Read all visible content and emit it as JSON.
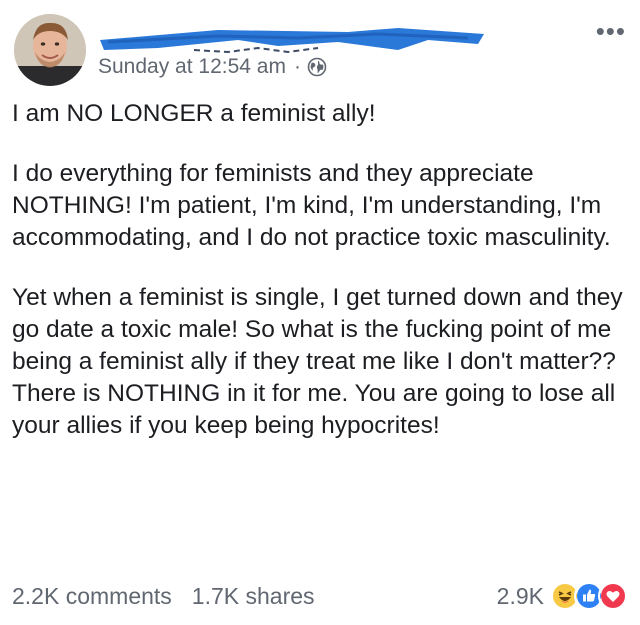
{
  "post": {
    "timestamp": "Sunday at 12:54 am",
    "separator": "·",
    "privacy_icon": "globe-icon",
    "more_options": "•••",
    "paragraphs": [
      "I am NO LONGER a feminist ally!",
      "I do everything for feminists and they appreciate NOTHING! I'm patient, I'm kind, I'm understanding, I'm accommodating, and I do not practice toxic masculinity.",
      "Yet when a feminist is single, I get turned down and they go date a toxic male! So what is the fucking point of me being a feminist ally if they treat me like I don't matter?? There is NOTHING in it for me. You are going to lose all your allies if you keep being hypocrites!"
    ]
  },
  "footer": {
    "comments": "2.2K comments",
    "shares": "1.7K shares",
    "reactions_count": "2.9K",
    "reactions": [
      "haha-icon",
      "like-icon",
      "love-icon"
    ]
  },
  "colors": {
    "redaction": "#2a78d8",
    "meta_text": "#616770",
    "body_text": "#1c1e21",
    "like": "#2e81f5",
    "love": "#f0384f",
    "haha": "#f7c944"
  }
}
